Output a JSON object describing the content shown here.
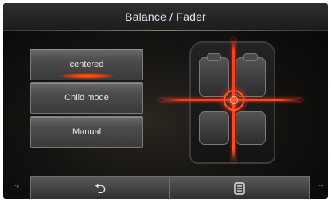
{
  "header": {
    "title": "Balance / Fader"
  },
  "modes": [
    {
      "label": "centered",
      "active": true
    },
    {
      "label": "Child mode",
      "active": false
    },
    {
      "label": "Manual",
      "active": false
    }
  ],
  "footer": {
    "unit_left": "°c",
    "unit_right": "°c",
    "back_icon": "back-arrow-icon",
    "menu_icon": "menu-list-icon"
  },
  "colors": {
    "accent": "#ff3a1a",
    "button": "#4c4c4c",
    "background": "#0a0a0a"
  }
}
